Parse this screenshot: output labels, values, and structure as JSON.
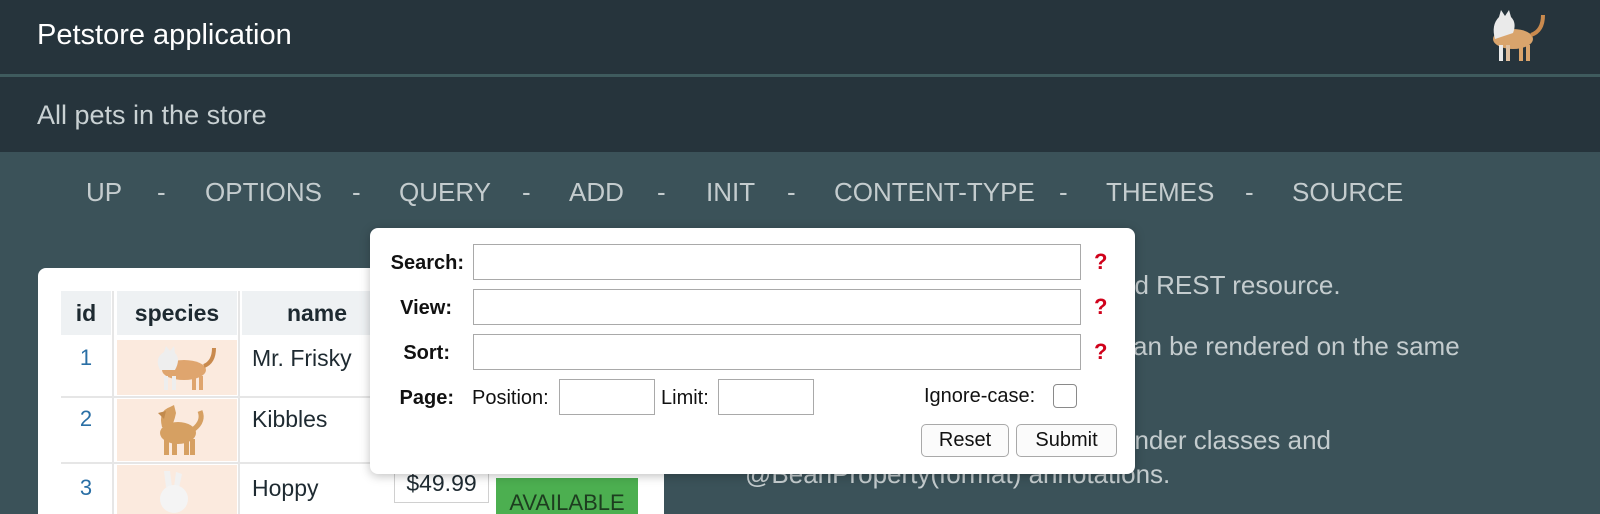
{
  "header": {
    "title": "Petstore application",
    "logo_icon": "cat-icon"
  },
  "subheader": {
    "title": "All pets in the store"
  },
  "nav": {
    "items": [
      "UP",
      "OPTIONS",
      "QUERY",
      "ADD",
      "INIT",
      "CONTENT-TYPE",
      "THEMES",
      "SOURCE"
    ],
    "separator": "-"
  },
  "description": {
    "line1": "ed REST resource.",
    "line2": "can be rendered on the same",
    "line3": "ender classes and",
    "line4": "@BeanProperty(format) annotations."
  },
  "table": {
    "columns": [
      "id",
      "species",
      "name"
    ],
    "rows": [
      {
        "id": "1",
        "species_icon": "cat-icon",
        "name": "Mr. Frisky"
      },
      {
        "id": "2",
        "species_icon": "dog-icon",
        "name": "Kibbles"
      },
      {
        "id": "3",
        "species_icon": "rabbit-icon",
        "name": "Hoppy",
        "price": "$49.99",
        "status": "AVAILABLE"
      }
    ]
  },
  "query": {
    "search_label": "Search:",
    "view_label": "View:",
    "sort_label": "Sort:",
    "page_label": "Page:",
    "position_label": "Position:",
    "limit_label": "Limit:",
    "ignore_case_label": "Ignore-case:",
    "help_glyph": "?",
    "reset_label": "Reset",
    "submit_label": "Submit",
    "search_value": "",
    "view_value": "",
    "sort_value": "",
    "position_value": "",
    "limit_value": "",
    "ignore_case_checked": false
  },
  "colors": {
    "header_bg": "#26343c",
    "page_bg": "#3b5259",
    "link": "#2a6fa5",
    "help": "#d0021b",
    "status": "#4caf50"
  }
}
